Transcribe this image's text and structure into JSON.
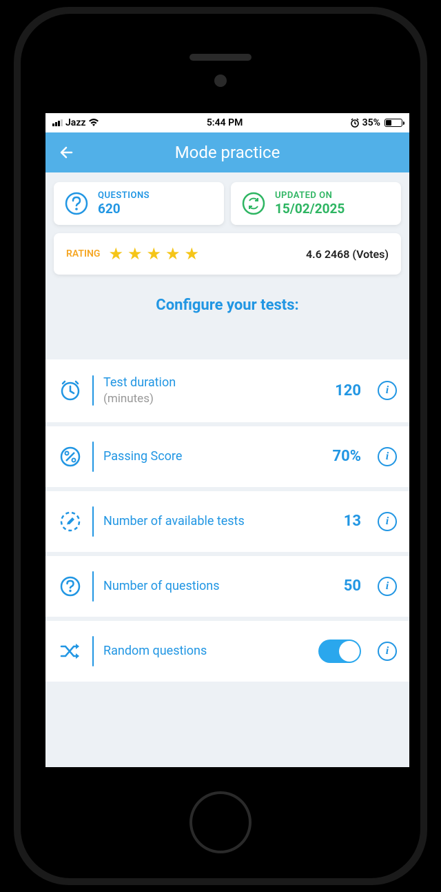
{
  "status": {
    "carrier": "Jazz",
    "time": "5:44 PM",
    "battery_pct": "35%"
  },
  "header": {
    "title": "Mode practice"
  },
  "cards": {
    "questions": {
      "label": "QUESTIONS",
      "value": "620"
    },
    "updated": {
      "label": "UPDATED ON",
      "value": "15/02/2025"
    },
    "rating": {
      "label": "RATING",
      "score": "4.6 2468 (Votes)"
    }
  },
  "configure_heading": "Configure your tests:",
  "rows": {
    "duration": {
      "label": "Test duration",
      "sub": "(minutes)",
      "value": "120"
    },
    "passing": {
      "label": "Passing Score",
      "value": "70%"
    },
    "tests": {
      "label": "Number of available tests",
      "value": "13"
    },
    "questions": {
      "label": "Number of questions",
      "value": "50"
    },
    "random": {
      "label": "Random questions",
      "on": true
    }
  }
}
